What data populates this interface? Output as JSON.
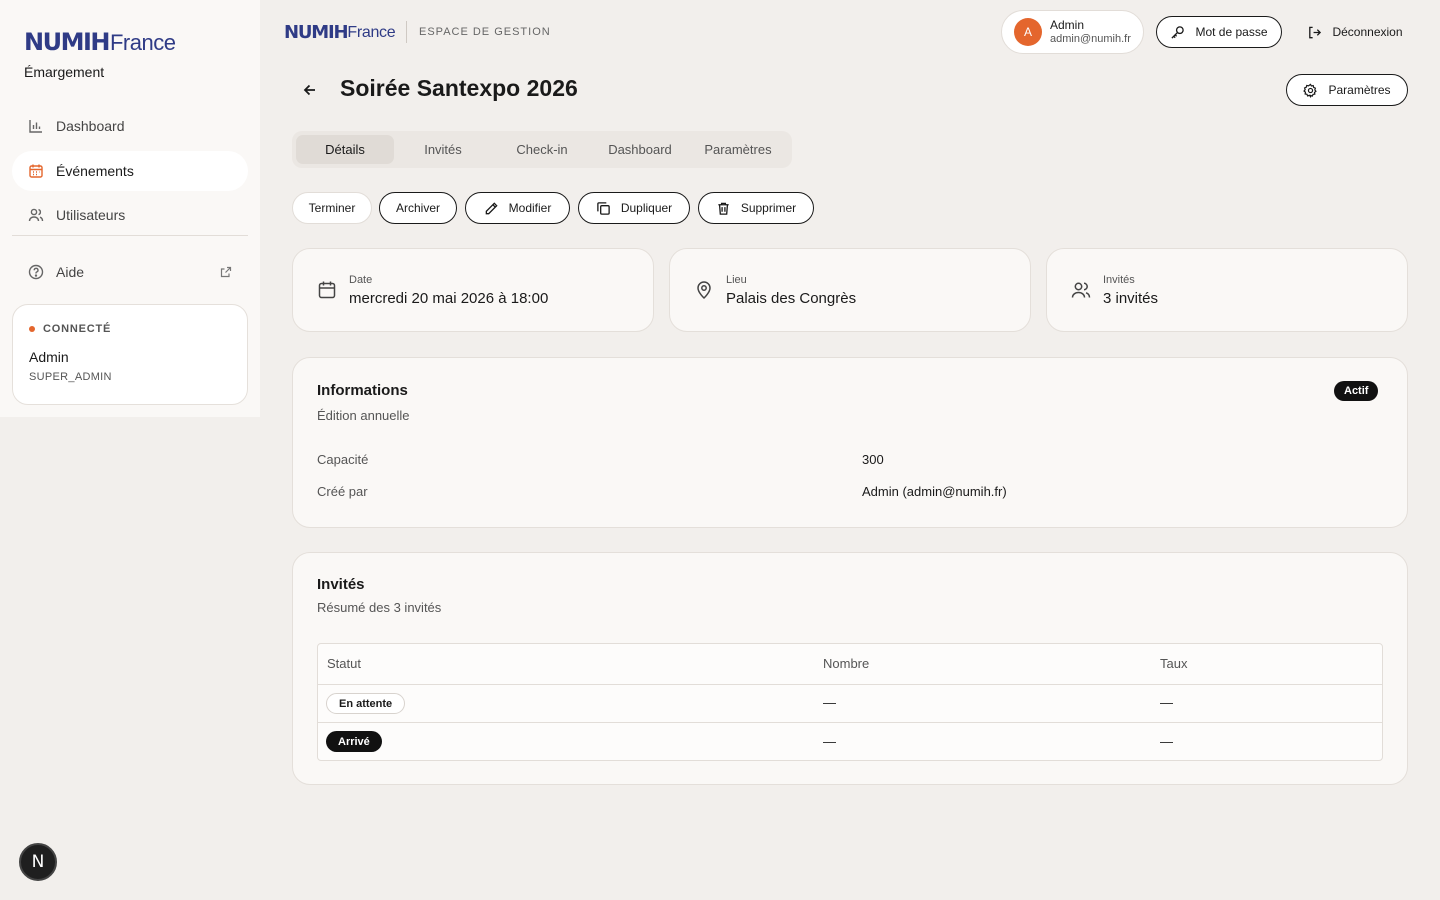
{
  "sidebar": {
    "logo_brand": "NUMIH",
    "logo_country": "France",
    "app_name": "Émargement",
    "nav": [
      {
        "label": "Dashboard",
        "icon": "bar-chart-icon"
      },
      {
        "label": "Événements",
        "icon": "calendar-icon"
      },
      {
        "label": "Utilisateurs",
        "icon": "users-icon"
      }
    ],
    "help_label": "Aide",
    "status": {
      "label": "CONNECTÉ",
      "name": "Admin",
      "role": "SUPER_ADMIN"
    }
  },
  "header": {
    "logo_brand": "NUMIH",
    "logo_country": "France",
    "space_label": "ESPACE DE GESTION",
    "user": {
      "initial": "A",
      "name": "Admin",
      "email": "admin@numih.fr"
    },
    "password_button": "Mot de passe",
    "logout_button": "Déconnexion"
  },
  "event": {
    "title": "Soirée Santexpo 2026",
    "settings_button": "Paramètres",
    "tabs": [
      "Détails",
      "Invités",
      "Check-in",
      "Dashboard",
      "Paramètres"
    ],
    "active_tab": "Détails",
    "actions": [
      "Terminer",
      "Archiver",
      "Modifier",
      "Dupliquer",
      "Supprimer"
    ],
    "cards": [
      {
        "label": "Date",
        "value": "mercredi 20 mai 2026 à 18:00"
      },
      {
        "label": "Lieu",
        "value": "Palais des Congrès"
      },
      {
        "label": "Invités",
        "value": "3 invités"
      }
    ]
  },
  "informations": {
    "title": "Informations",
    "subtitle": "Édition annuelle",
    "status_badge": "Actif",
    "rows": [
      {
        "key": "Capacité",
        "value": "300"
      },
      {
        "key": "Créé par",
        "value": "Admin (admin@numih.fr)"
      }
    ]
  },
  "guests": {
    "title": "Invités",
    "subtitle": "Résumé des 3 invités",
    "columns": [
      "Statut",
      "Nombre",
      "Taux"
    ],
    "rows": [
      {
        "status": "En attente",
        "count": "—",
        "rate": "—"
      },
      {
        "status": "Arrivé",
        "count": "—",
        "rate": "—"
      }
    ]
  },
  "dev_badge": "N",
  "colors": {
    "accent": "#e4662d",
    "brand": "#2f3b86",
    "background": "#f2efec"
  }
}
